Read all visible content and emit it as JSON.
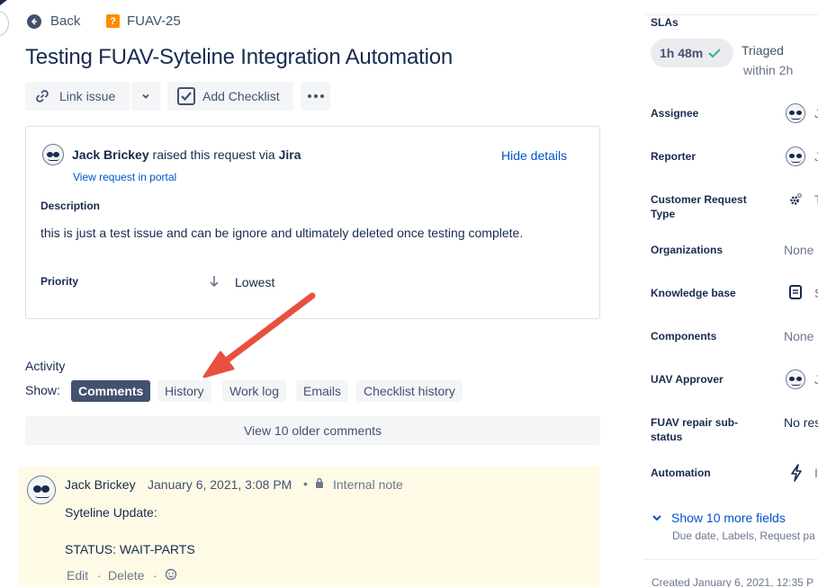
{
  "header": {
    "back_label": "Back",
    "issue_key": "FUAV-25",
    "title": "Testing FUAV-Syteline Integration Automation"
  },
  "toolbar": {
    "link_issue_label": "Link issue",
    "add_checklist_label": "Add Checklist"
  },
  "request": {
    "reporter": "Jack Brickey",
    "raised_text": " raised this request via ",
    "channel": "Jira",
    "portal_link": "View request in portal",
    "hide_details": "Hide details",
    "description_label": "Description",
    "description_text": "this is just a test issue and can be ignore and ultimately deleted once testing complete.",
    "priority_label": "Priority",
    "priority_value": "Lowest"
  },
  "activity": {
    "heading": "Activity",
    "show_label": "Show:",
    "tabs": [
      "Comments",
      "History",
      "Work log",
      "Emails",
      "Checklist history"
    ],
    "active_tab": "Comments",
    "older_comments": "View 10 older comments"
  },
  "comment": {
    "author": "Jack Brickey",
    "date": "January 6, 2021, 3:08 PM",
    "separator": "•",
    "visibility": "Internal note",
    "line1": "Syteline Update:",
    "line2": "STATUS: WAIT-PARTS",
    "edit": "Edit",
    "delete": "Delete",
    "dot": "·"
  },
  "sidebar": {
    "slas_label": "SLAs",
    "sla_time": "1h 48m",
    "sla_status": "Triaged",
    "sla_goal": "within 2h",
    "fields": [
      {
        "label": "Assignee",
        "value": "J"
      },
      {
        "label": "Reporter",
        "value": "J"
      },
      {
        "label": "Customer Request Type",
        "value": "T"
      },
      {
        "label": "Organizations",
        "value": "None"
      },
      {
        "label": "Knowledge base",
        "value": "S"
      },
      {
        "label": "Components",
        "value": "None"
      },
      {
        "label": "UAV Approver",
        "value": "J"
      },
      {
        "label": "FUAV repair sub-status",
        "value": "No res"
      },
      {
        "label": "Automation",
        "value": "I"
      }
    ],
    "show_more": "Show 10 more fields",
    "show_more_sub": "Due date, Labels, Request pa",
    "created": "Created January 6, 2021, 12:35 P"
  },
  "colors": {
    "accent": "#0052cc",
    "active_tab_bg": "#42526e",
    "internal_note_bg": "#fffae6",
    "arrow": "#e8503f",
    "sla_check": "#36b37e",
    "issue_icon": "#ff8b00"
  },
  "icons": [
    "arrow-left-icon",
    "question-square-icon",
    "link-icon",
    "chevron-down-icon",
    "checkbox-icon",
    "more-icon",
    "avatar-icon",
    "arrow-down-icon",
    "lock-icon",
    "emoji-icon",
    "checkmark-icon",
    "gear-icon",
    "book-icon",
    "lightning-icon"
  ]
}
